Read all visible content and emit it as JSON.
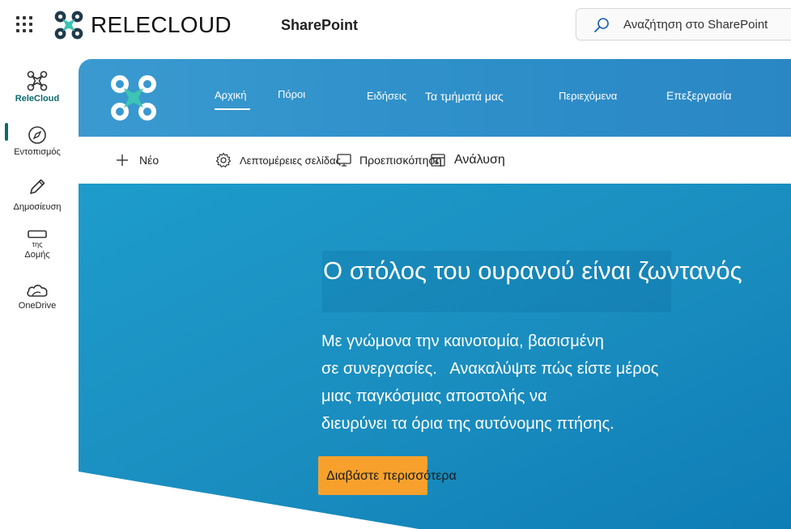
{
  "suite_bar": {
    "brand_name": "RELECLOUD",
    "app_name": "SharePoint",
    "search_placeholder": "Αναζήτηση στο SharePoint"
  },
  "rail": {
    "items": [
      {
        "label": "ReleCloud",
        "icon": "relecloud-logo-icon",
        "active": true
      },
      {
        "label": "Εντοπισμός",
        "icon": "compass-icon"
      },
      {
        "label": "Δημοσίευση",
        "icon": "pencil-icon"
      },
      {
        "label_line1": "της",
        "label_line2": "Δομής",
        "icon": "rectangle-icon"
      },
      {
        "label": "OneDrive",
        "icon": "onedrive-cloud-icon"
      }
    ]
  },
  "site_nav": {
    "items": [
      "Αρχική",
      "Πόροι",
      "Ειδήσεις",
      "Τα τμήματά μας",
      "Περιεχόμενα",
      "Επεξεργασία"
    ],
    "active_index": 0
  },
  "command_bar": {
    "new_label": "Νέο",
    "page_details_label": "Λεπτομέρειες σελίδας",
    "preview_label": "Προεπισκόπηση",
    "analytics_label": "Ανάλυση"
  },
  "hero": {
    "title": "Ο στόλος του ουρανού είναι ζωντανός",
    "body": "Με γνώμονα την καινοτομία, βασισμένη\nσε συνεργασίες.   Ανακαλύψτε πώς είστε μέρος\nμιας παγκόσμιας αποστολής να\nδιευρύνει τα όρια της αυτόνομης πτήσης.",
    "button_label": "Διαβάστε περισσότερα"
  },
  "colors": {
    "accent_teal": "#0b6a6e",
    "header_blue": "#3a9ad0",
    "hero_blue": "#1f95c4",
    "button_orange": "#f7a12c",
    "logo_teal": "#3cc4b4"
  }
}
